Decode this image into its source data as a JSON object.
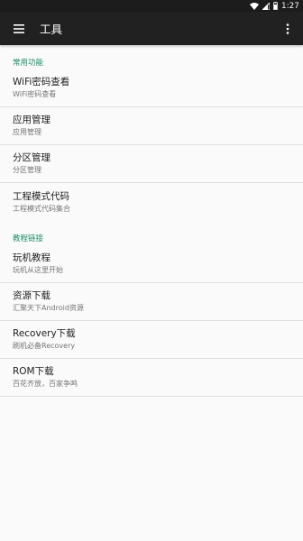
{
  "status_bar": {
    "time": "1:27",
    "icons": [
      "wifi-icon",
      "signal-icon",
      "battery-icon"
    ]
  },
  "app_bar": {
    "title": "工具",
    "menu_icon": "hamburger-menu-icon",
    "more_icon": "more-vert-icon"
  },
  "sections": [
    {
      "header": "常用功能",
      "items": [
        {
          "title": "WiFi密码查看",
          "subtitle": "WiFi密码查看"
        },
        {
          "title": "应用管理",
          "subtitle": "应用管理"
        },
        {
          "title": "分区管理",
          "subtitle": "分区管理"
        },
        {
          "title": "工程模式代码",
          "subtitle": "工程模式代码集合"
        }
      ]
    },
    {
      "header": "教程链接",
      "items": [
        {
          "title": "玩机教程",
          "subtitle": "玩机从这里开始"
        },
        {
          "title": "资源下载",
          "subtitle": "汇聚天下Android资源"
        },
        {
          "title": "Recovery下载",
          "subtitle": "刷机必备Recovery"
        },
        {
          "title": "ROM下载",
          "subtitle": "百花齐放，百家争鸣"
        }
      ]
    }
  ],
  "colors": {
    "toolbar": "#212121",
    "status_bar": "#1c1c1c",
    "accent": "#1e8e6b",
    "background": "#fafafa"
  }
}
